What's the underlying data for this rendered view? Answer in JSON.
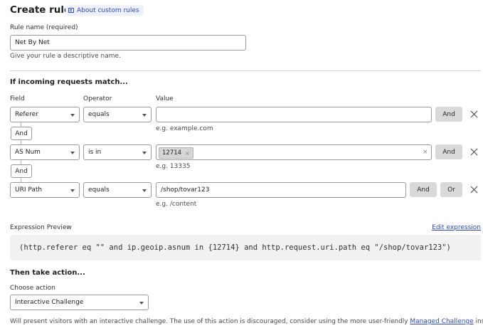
{
  "header": {
    "title": "Create rule",
    "about_link": "About custom rules"
  },
  "rule_name": {
    "label": "Rule name (required)",
    "value": "Net By Net",
    "hint": "Give your rule a descriptive name."
  },
  "match": {
    "section_title": "If incoming requests match...",
    "col_field": "Field",
    "col_operator": "Operator",
    "col_value": "Value",
    "connector_label": "And",
    "rows": [
      {
        "field": "Referer",
        "operator": "equals",
        "value": "",
        "hint": "e.g. example.com",
        "and_label": "And"
      },
      {
        "field": "AS Num",
        "operator": "is in",
        "tags": [
          "12714"
        ],
        "hint": "e.g. 13335",
        "and_label": "And"
      },
      {
        "field": "URI Path",
        "operator": "equals",
        "value": "/shop/tovar123",
        "hint": "e.g. /content",
        "and_label": "And",
        "or_label": "Or"
      }
    ]
  },
  "expression": {
    "label": "Expression Preview",
    "edit_link": "Edit expression",
    "code": "(http.referer eq \"\" and ip.geoip.asnum in {12714} and http.request.uri.path eq \"/shop/tovar123\")"
  },
  "action": {
    "section_title": "Then take action...",
    "label": "Choose action",
    "selected": "Interactive Challenge",
    "footer_text": "Will present visitors with an interactive challenge. The use of this action is discouraged, consider using the more user-friendly ",
    "footer_link": "Managed Challenge",
    "footer_end": " instead."
  },
  "icons": {
    "about": "book-icon",
    "dropdown": "chevron-down-icon",
    "remove": "close-icon"
  }
}
